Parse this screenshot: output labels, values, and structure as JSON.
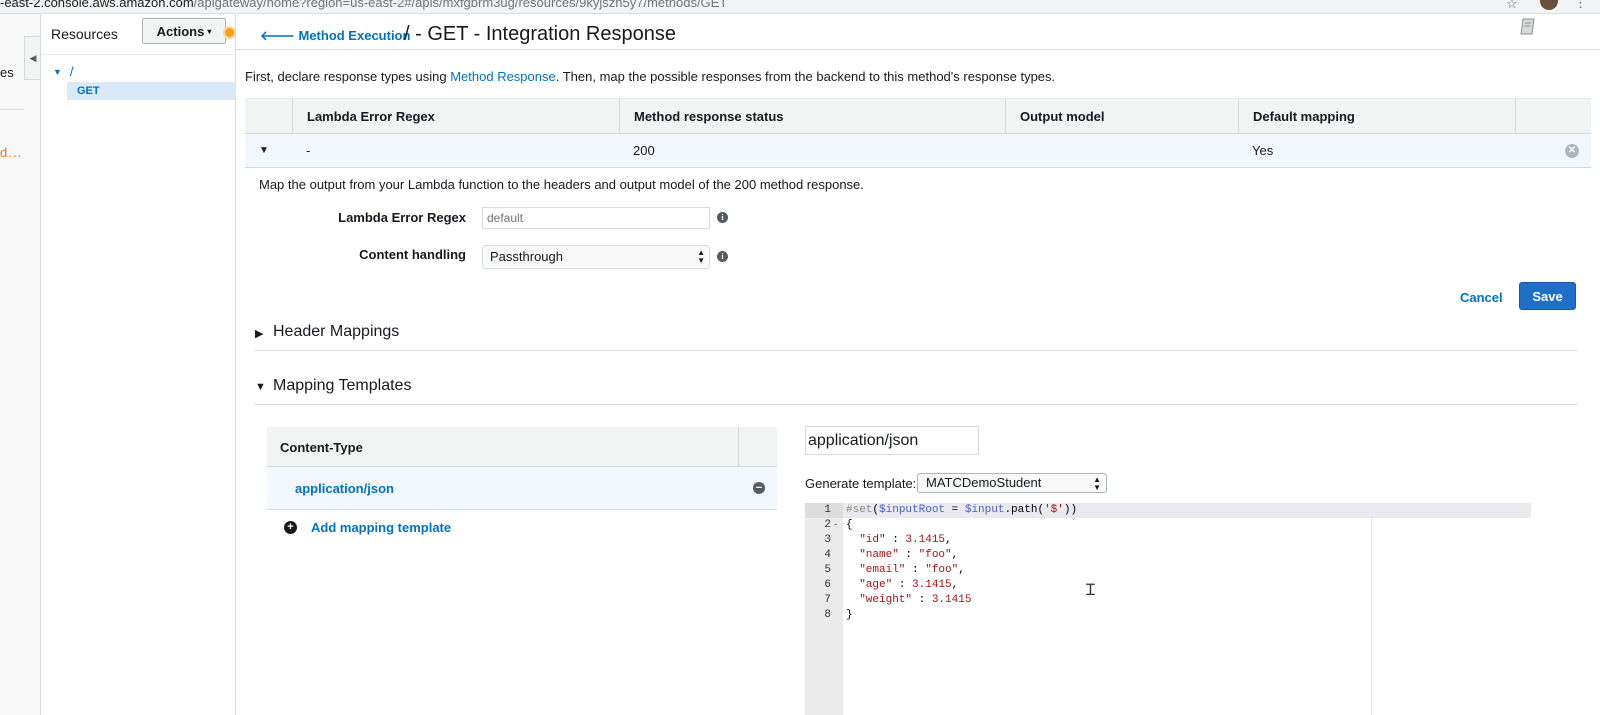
{
  "browser": {
    "url_host": "-east-2.console.aws.amazon.com",
    "url_path": "/apigateway/home?region=us-east-2#/apis/mxfgbrm3ug/resources/9kyjszh5y7/methods/GET"
  },
  "nav_strip": {
    "fragment_top": "es",
    "fragment_bottom": "d..."
  },
  "resources_panel": {
    "title": "Resources",
    "actions_label": "Actions",
    "tree": {
      "root": "/",
      "selected": "GET"
    }
  },
  "header": {
    "back_label": "Method Execution",
    "title": "/ - GET - Integration Response"
  },
  "intro": {
    "before": "First, declare response types using ",
    "link": "Method Response",
    "after": ". Then, map the possible responses from the backend to this method's response types."
  },
  "response_table": {
    "columns": [
      "Lambda Error Regex",
      "Method response status",
      "Output model",
      "Default mapping"
    ],
    "rows": [
      {
        "regex": "-",
        "status": "200",
        "output_model": "",
        "default_mapping": "Yes"
      }
    ]
  },
  "detail": {
    "description": "Map the output from your Lambda function to the headers and output model of the 200 method response.",
    "regex_label": "Lambda Error Regex",
    "regex_placeholder": "default",
    "handling_label": "Content handling",
    "handling_value": "Passthrough",
    "cancel_label": "Cancel",
    "save_label": "Save"
  },
  "sections": {
    "header_mappings": "Header Mappings",
    "mapping_templates": "Mapping Templates"
  },
  "content_types": {
    "header": "Content-Type",
    "items": [
      "application/json"
    ],
    "add_label": "Add mapping template"
  },
  "template_editor": {
    "content_type_value": "application/json",
    "generate_label": "Generate template:",
    "generate_value": "MATCDemoStudent",
    "line_numbers": [
      "1",
      "2",
      "3",
      "4",
      "5",
      "6",
      "7",
      "8"
    ],
    "fold_marker": "-"
  },
  "colors": {
    "link": "#0073bb",
    "primary_button": "#1e6fc5",
    "selected_row": "#f1f7fc",
    "header_bg": "#f2f3f3"
  }
}
